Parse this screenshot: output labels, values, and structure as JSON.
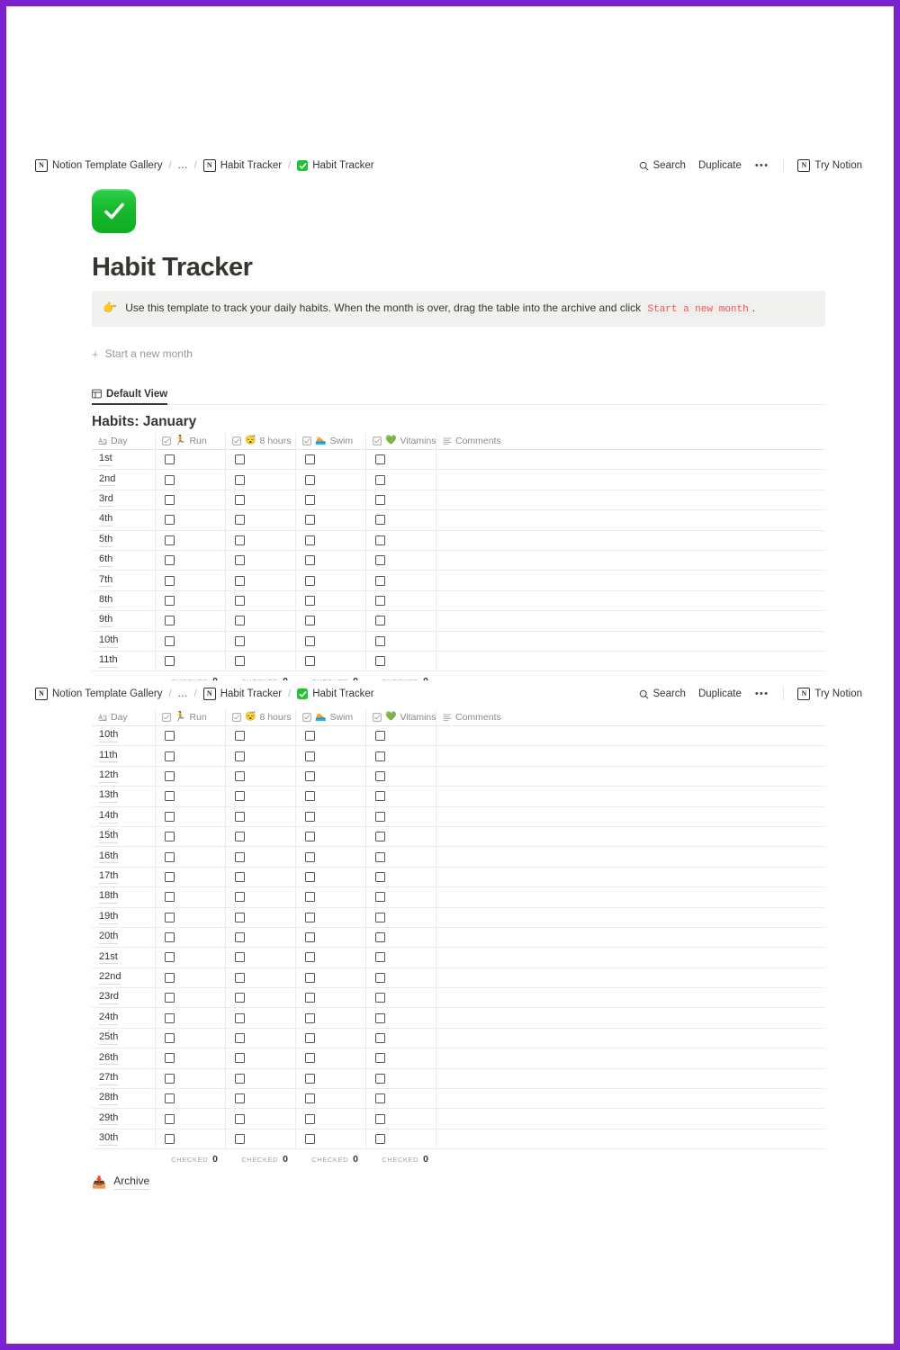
{
  "topbar": {
    "breadcrumb": [
      {
        "icon": "notion-logo-icon",
        "label": "Notion Template Gallery"
      },
      {
        "icon": "none",
        "label": "..."
      },
      {
        "icon": "notion-logo-icon",
        "label": "Habit Tracker"
      },
      {
        "icon": "green-check-icon",
        "label": "Habit Tracker"
      }
    ],
    "separator": "/",
    "search_label": "Search",
    "duplicate_label": "Duplicate",
    "more_label": "•••",
    "try_notion_label": "Try Notion"
  },
  "page": {
    "emoji": "white-check-mark",
    "title": "Habit Tracker",
    "callout": {
      "emoji": "👉",
      "text_before": "Use this template to track your daily habits. When the month is over, drag the table into the archive and click",
      "code": "Start a new month",
      "text_after": "."
    },
    "new_month_button": "Start a new month",
    "new_month_plus": "+",
    "view_tab": "Default View",
    "archive_emoji": "📥",
    "archive_label": "Archive"
  },
  "database": {
    "title": "Habits: January",
    "columns": [
      {
        "key": "day",
        "type_icon": "text-property-icon",
        "emoji": "",
        "label": "Day"
      },
      {
        "key": "run",
        "type_icon": "checkbox-property-icon",
        "emoji": "🏃",
        "label": "Run"
      },
      {
        "key": "sleep",
        "type_icon": "checkbox-property-icon",
        "emoji": "😴",
        "label": "8 hours"
      },
      {
        "key": "swim",
        "type_icon": "checkbox-property-icon",
        "emoji": "🏊",
        "label": "Swim"
      },
      {
        "key": "vitamins",
        "type_icon": "checkbox-property-icon",
        "emoji": "💚",
        "label": "Vitamins"
      },
      {
        "key": "comments",
        "type_icon": "text-multiline-icon",
        "emoji": "",
        "label": "Comments"
      }
    ],
    "table1_rows": [
      {
        "day": "1st",
        "run": false,
        "sleep": false,
        "swim": false,
        "vitamins": false,
        "comments": ""
      },
      {
        "day": "2nd",
        "run": false,
        "sleep": false,
        "swim": false,
        "vitamins": false,
        "comments": ""
      },
      {
        "day": "3rd",
        "run": false,
        "sleep": false,
        "swim": false,
        "vitamins": false,
        "comments": ""
      },
      {
        "day": "4th",
        "run": false,
        "sleep": false,
        "swim": false,
        "vitamins": false,
        "comments": ""
      },
      {
        "day": "5th",
        "run": false,
        "sleep": false,
        "swim": false,
        "vitamins": false,
        "comments": ""
      },
      {
        "day": "6th",
        "run": false,
        "sleep": false,
        "swim": false,
        "vitamins": false,
        "comments": ""
      },
      {
        "day": "7th",
        "run": false,
        "sleep": false,
        "swim": false,
        "vitamins": false,
        "comments": ""
      },
      {
        "day": "8th",
        "run": false,
        "sleep": false,
        "swim": false,
        "vitamins": false,
        "comments": ""
      },
      {
        "day": "9th",
        "run": false,
        "sleep": false,
        "swim": false,
        "vitamins": false,
        "comments": ""
      },
      {
        "day": "10th",
        "run": false,
        "sleep": false,
        "swim": false,
        "vitamins": false,
        "comments": ""
      },
      {
        "day": "11th",
        "run": false,
        "sleep": false,
        "swim": false,
        "vitamins": false,
        "comments": ""
      }
    ],
    "table2_rows": [
      {
        "day": "10th",
        "run": false,
        "sleep": false,
        "swim": false,
        "vitamins": false,
        "comments": ""
      },
      {
        "day": "11th",
        "run": false,
        "sleep": false,
        "swim": false,
        "vitamins": false,
        "comments": ""
      },
      {
        "day": "12th",
        "run": false,
        "sleep": false,
        "swim": false,
        "vitamins": false,
        "comments": ""
      },
      {
        "day": "13th",
        "run": false,
        "sleep": false,
        "swim": false,
        "vitamins": false,
        "comments": ""
      },
      {
        "day": "14th",
        "run": false,
        "sleep": false,
        "swim": false,
        "vitamins": false,
        "comments": ""
      },
      {
        "day": "15th",
        "run": false,
        "sleep": false,
        "swim": false,
        "vitamins": false,
        "comments": ""
      },
      {
        "day": "16th",
        "run": false,
        "sleep": false,
        "swim": false,
        "vitamins": false,
        "comments": ""
      },
      {
        "day": "17th",
        "run": false,
        "sleep": false,
        "swim": false,
        "vitamins": false,
        "comments": ""
      },
      {
        "day": "18th",
        "run": false,
        "sleep": false,
        "swim": false,
        "vitamins": false,
        "comments": ""
      },
      {
        "day": "19th",
        "run": false,
        "sleep": false,
        "swim": false,
        "vitamins": false,
        "comments": ""
      },
      {
        "day": "20th",
        "run": false,
        "sleep": false,
        "swim": false,
        "vitamins": false,
        "comments": ""
      },
      {
        "day": "21st",
        "run": false,
        "sleep": false,
        "swim": false,
        "vitamins": false,
        "comments": ""
      },
      {
        "day": "22nd",
        "run": false,
        "sleep": false,
        "swim": false,
        "vitamins": false,
        "comments": ""
      },
      {
        "day": "23rd",
        "run": false,
        "sleep": false,
        "swim": false,
        "vitamins": false,
        "comments": ""
      },
      {
        "day": "24th",
        "run": false,
        "sleep": false,
        "swim": false,
        "vitamins": false,
        "comments": ""
      },
      {
        "day": "25th",
        "run": false,
        "sleep": false,
        "swim": false,
        "vitamins": false,
        "comments": ""
      },
      {
        "day": "26th",
        "run": false,
        "sleep": false,
        "swim": false,
        "vitamins": false,
        "comments": ""
      },
      {
        "day": "27th",
        "run": false,
        "sleep": false,
        "swim": false,
        "vitamins": false,
        "comments": ""
      },
      {
        "day": "28th",
        "run": false,
        "sleep": false,
        "swim": false,
        "vitamins": false,
        "comments": ""
      },
      {
        "day": "29th",
        "run": false,
        "sleep": false,
        "swim": false,
        "vitamins": false,
        "comments": ""
      },
      {
        "day": "30th",
        "run": false,
        "sleep": false,
        "swim": false,
        "vitamins": false,
        "comments": ""
      }
    ],
    "footer": {
      "label": "CHECKED",
      "values": [
        "0",
        "0",
        "0",
        "0"
      ]
    }
  },
  "colors": {
    "frame_purple": "#7b21ce",
    "emoji_green": "#16b82c",
    "code_red": "#eb5757",
    "callout_bg": "#f1f1ef",
    "text": "#37352f"
  }
}
